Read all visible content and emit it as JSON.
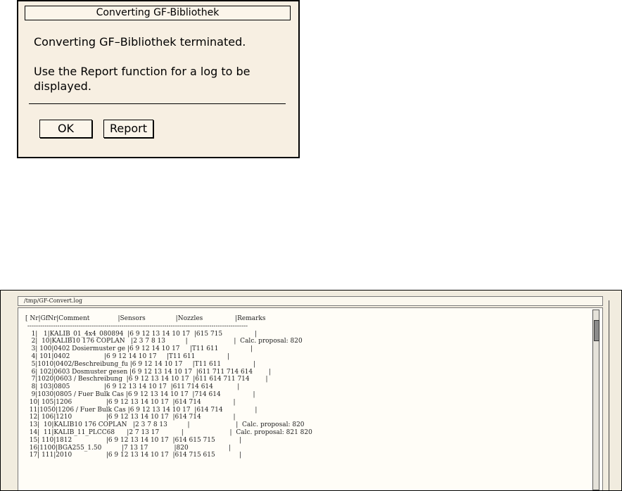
{
  "dialog": {
    "title": "Converting GF-Bibliothek",
    "message": "Converting GF–Bibliothek terminated.",
    "hint": "Use the Report function for a log to be displayed.",
    "ok_label": "OK",
    "report_label": "Report"
  },
  "log": {
    "path": "/tmp/GF-Convert.log",
    "lines": [
      "[ Nr|GfNr|Comment              |Sensors               |Nozzles                |Remarks",
      " -------------------------------------------------------------------------------------------------------",
      "   1|   1|KALIB_01_4x4_080894  |6 9 12 13 14 10 17  |615 715                |",
      "   2|  10|KALIB10 176 COPLAN   |2 3 7 8 13          |                       |  Calc. proposal: 820",
      "   3| 100|0402 Dosiermuster ge |6 9 12 14 10 17     |T11 611                |",
      "   4| 101|0402                 |6 9 12 14 10 17     |T11 611                |",
      "   5|1010|0402/Beschreibung_fu |6 9 12 14 10 17     |T11 611                |",
      "   6| 102|0603 Dosmuster gesen |6 9 12 13 14 10 17  |611 711 714 614        |",
      "   7|1020|0603 / Beschreibung  |6 9 12 13 14 10 17  |611 614 711 714        |",
      "   8| 103|0805                 |6 9 12 13 14 10 17  |611 714 614            |",
      "   9|1030|0805 / Fuer Bulk Cas |6 9 12 13 14 10 17  |714 614                |",
      "  10| 105|1206                 |6 9 12 13 14 10 17  |614 714                |",
      "  11|1050|1206 / Fuer Bulk Cas |6 9 12 13 14 10 17  |614 714                |",
      "  12| 106|1210                 |6 9 12 13 14 10 17  |614 714                |",
      "  13|  10|KALIB10 176 COPLAN   |2 3 7 8 13          |                       |  Calc. proposal: 820",
      "  14|  11|KALIB_11_PLCC68      |2 7 13 17           |                       |  Calc. proposal: 821 820",
      "  15| 110|1812                 |6 9 12 13 14 10 17  |614 615 715            |",
      "  16|1100|BGA255_1.50          |7 13 17             |820                    |",
      "  17| 111|2010                 |6 9 12 13 14 10 17  |614 715 615            |"
    ]
  }
}
